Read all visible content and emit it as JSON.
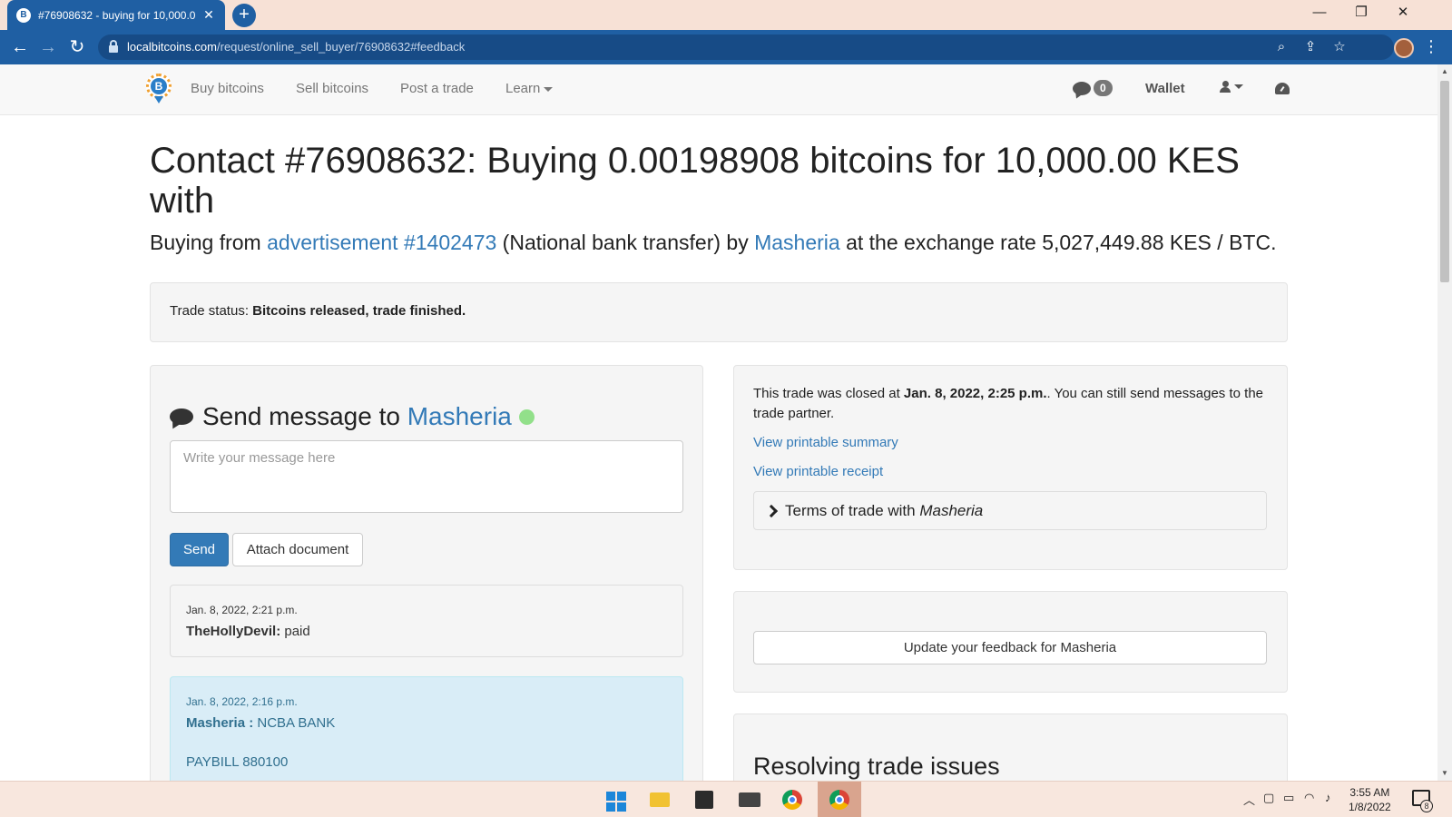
{
  "browser": {
    "tab_title": "#76908632 - buying for 10,000.0",
    "tab_favicon": "B",
    "tab_close": "✕",
    "new_tab": "+",
    "url_host": "localbitcoins.com",
    "url_path": "/request/online_sell_buyer/76908632#feedback",
    "window_controls": {
      "minimize": "—",
      "maximize": "❐",
      "close": "✕"
    }
  },
  "nav": {
    "buy": "Buy bitcoins",
    "sell": "Sell bitcoins",
    "post": "Post a trade",
    "learn": "Learn",
    "messages_count": "0",
    "wallet": "Wallet"
  },
  "page": {
    "title": "Contact #76908632: Buying 0.00198908 bitcoins for 10,000.00 KES with",
    "subtitle_prefix": "Buying from ",
    "ad_link": "advertisement #1402473",
    "subtitle_method": " (National bank transfer) by ",
    "trader": "Masheria",
    "subtitle_rate": " at the exchange rate 5,027,449.88 KES / BTC.",
    "status_label": "Trade status: ",
    "status_value": "Bitcoins released, trade finished."
  },
  "chat": {
    "heading": "Send message to ",
    "partner": "Masheria",
    "placeholder": "Write your message here",
    "send": "Send",
    "attach": "Attach document",
    "messages": [
      {
        "time": "Jan. 8, 2022, 2:21 p.m.",
        "author": "TheHollyDevil:",
        "text": " paid"
      },
      {
        "time": "Jan. 8, 2022, 2:16 p.m.",
        "author": "Masheria :",
        "text": " NCBA BANK",
        "extra": "PAYBILL 880100"
      }
    ]
  },
  "sidebar": {
    "closed_prefix": "This trade was closed at ",
    "closed_time": "Jan. 8, 2022, 2:25 p.m.",
    "closed_suffix": ". You can still send messages to the trade partner.",
    "printable_summary": "View printable summary",
    "printable_receipt": "View printable receipt",
    "terms_prefix": "Terms of trade with ",
    "terms_partner": "Masheria",
    "feedback_button": "Update your feedback for Masheria",
    "resolving_title": "Resolving trade issues"
  },
  "taskbar": {
    "time": "3:55 AM",
    "date": "1/8/2022",
    "notifications": "8"
  },
  "colors": {
    "link": "#337ab7",
    "browser_accent": "#1f5fa3",
    "online": "#92e08a",
    "taskbar": "#f8e7de"
  }
}
